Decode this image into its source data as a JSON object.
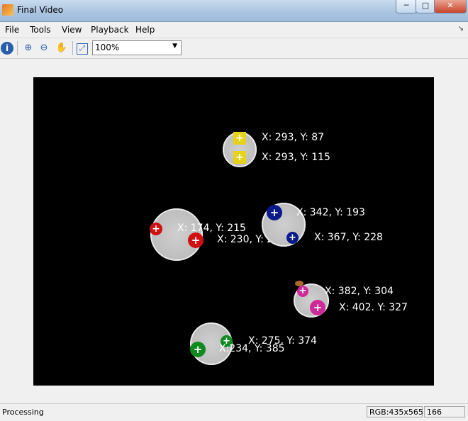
{
  "window": {
    "title": "Final Video",
    "min_label": "─",
    "max_label": "□",
    "close_label": "✕"
  },
  "menu": {
    "items": [
      "File",
      "Tools",
      "View",
      "Playback",
      "Help"
    ],
    "arrow": "↘"
  },
  "toolbar": {
    "info_glyph": "i",
    "zoom_in_glyph": "⊕",
    "zoom_out_glyph": "⊖",
    "pan_glyph": "✋",
    "fit_glyph": "⤢",
    "zoom_value": "100%",
    "zoom_arrow": "▼"
  },
  "markers": {
    "cross_glyph": "+",
    "colors": {
      "yellow": "#e6d21a",
      "red": "#d01010",
      "blue": "#0a1a8a",
      "magenta": "#d02a9a",
      "green": "#108a20"
    }
  },
  "coordinates": {
    "yellow_top": "X: 293, Y:  87",
    "yellow_bottom": "X: 293, Y: 115",
    "red_left": "X: 174, Y: 215",
    "red_right": "X: 230, Y: 231",
    "blue_top": "X: 342, Y: 193",
    "blue_bottom": "X: 367, Y: 228",
    "magenta_top": "X: 382, Y: 304",
    "magenta_bottom": "X: 402. Y: 327",
    "green_right": "X: 275, Y: 374",
    "green_left": "X:234, Y: 385"
  },
  "status": {
    "text": "Processing",
    "rgb": "RGB:435x565",
    "value": "166"
  }
}
